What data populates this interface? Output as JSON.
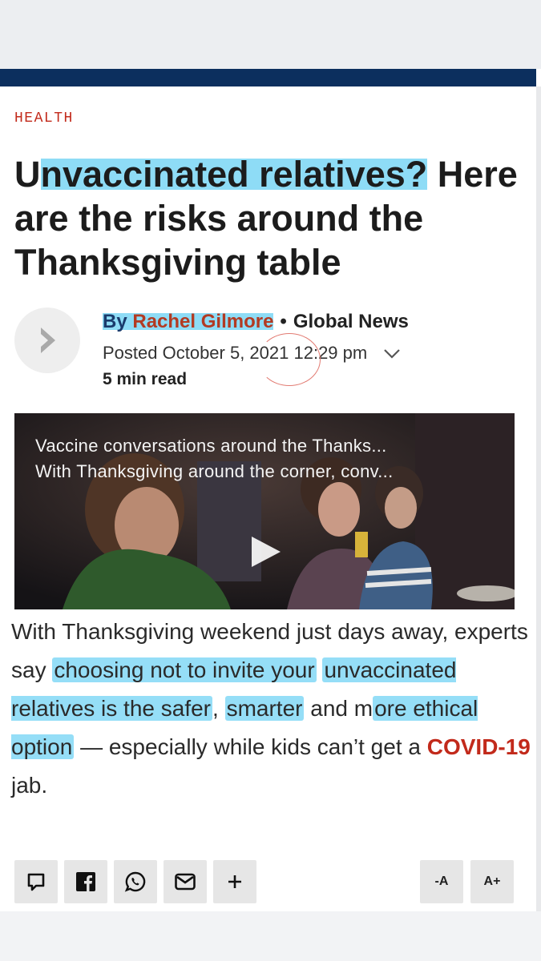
{
  "category": "HEALTH",
  "headline": {
    "part1": "U",
    "part2": "nvaccinated relatives?",
    "part3": " Here are the risks around the Thanksgiving table"
  },
  "byline": {
    "by": "By ",
    "author": "Rachel Gilmore",
    "dot": "•",
    "outlet": "Global News",
    "posted": "Posted October 5, 2021 12:29 pm",
    "read_time": "5 min read"
  },
  "video": {
    "title": "Vaccine conversations around the Thanks...",
    "description": "With Thanksgiving around the corner, conv..."
  },
  "body": {
    "t1": "With Thanksgiving weekend just days away, experts say ",
    "h1": "choosing not to invite your",
    "t2": " ",
    "h2": "unvaccinated relatives is the safer",
    "t3": ", ",
    "h3": "smarter",
    "t4": " and m",
    "h4": "ore ethical option",
    "t5": " — especially while kids can’t get a ",
    "link": "COVID-19",
    "t6": " jab."
  },
  "font_controls": {
    "decrease": "-A",
    "increase": "A+"
  },
  "colors": {
    "nav": "#0c2f5e",
    "accent_red": "#c22a1b",
    "highlighter": "#7ad6f5"
  },
  "icons": [
    "comment-icon",
    "facebook-icon",
    "whatsapp-icon",
    "email-icon",
    "plus-icon",
    "chevron-right-icon",
    "chevron-down-icon",
    "play-icon"
  ]
}
